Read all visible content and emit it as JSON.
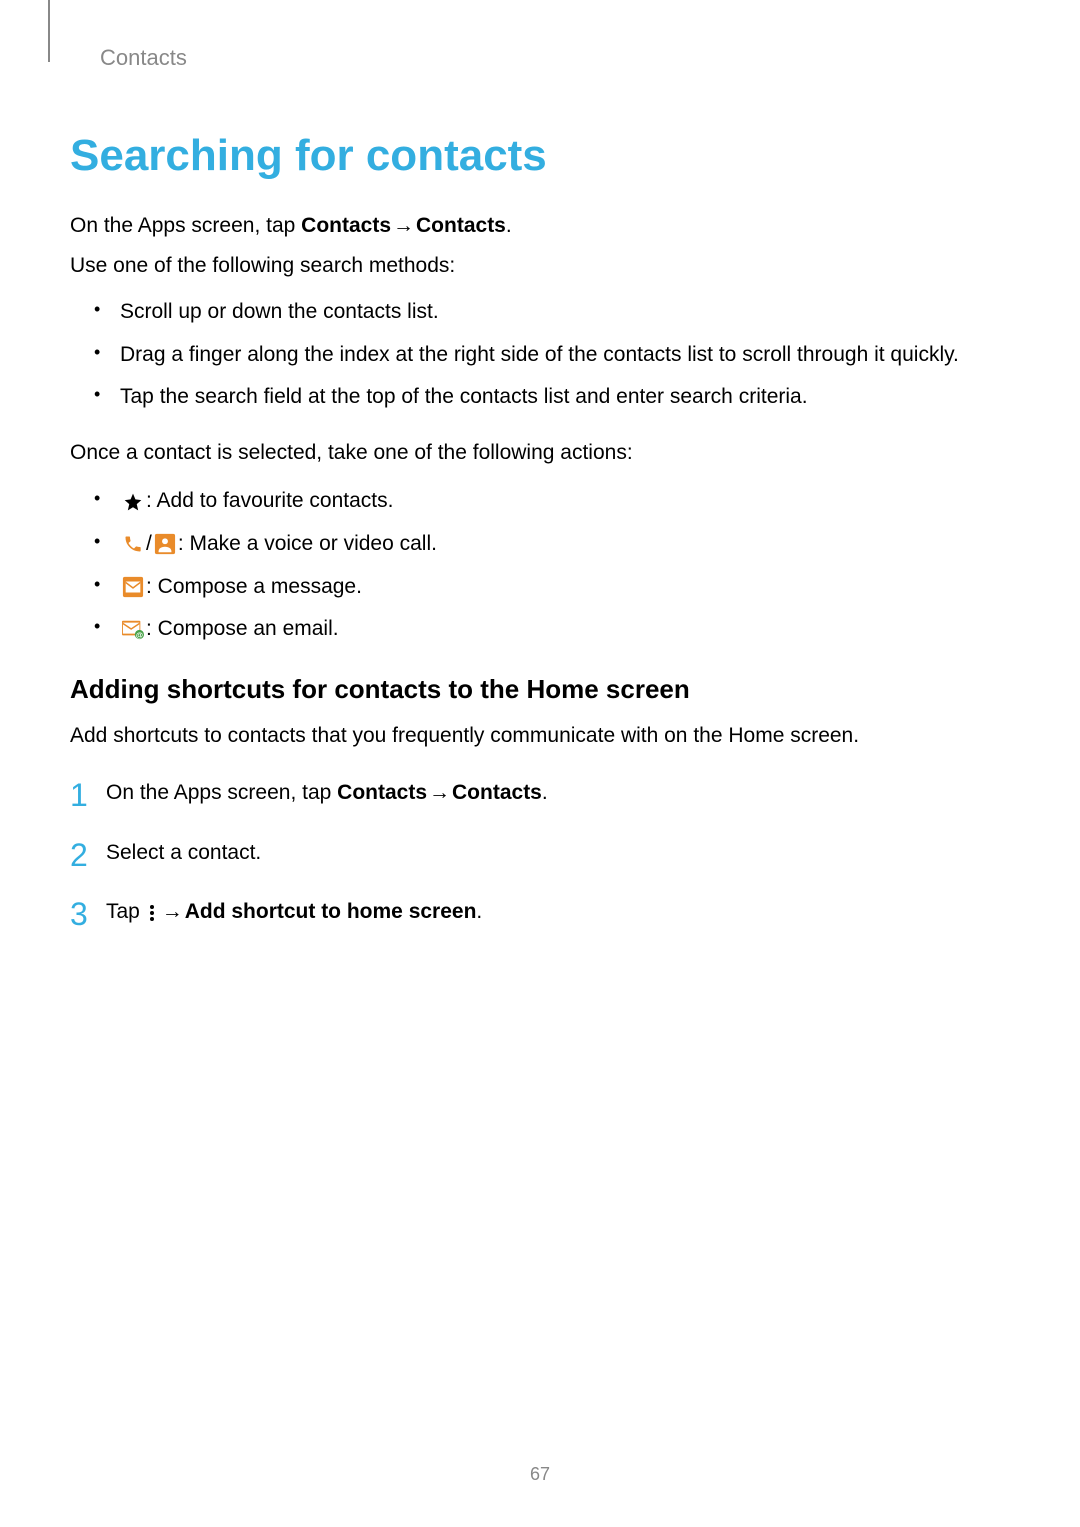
{
  "header": {
    "section": "Contacts"
  },
  "heading": "Searching for contacts",
  "intro": {
    "prefix": "On the Apps screen, tap ",
    "bold1": "Contacts",
    "arrow": " → ",
    "bold2": "Contacts",
    "suffix": "."
  },
  "intro2": "Use one of the following search methods:",
  "search_methods": [
    "Scroll up or down the contacts list.",
    "Drag a finger along the index at the right side of the contacts list to scroll through it quickly.",
    "Tap the search field at the top of the contacts list and enter search criteria."
  ],
  "after_select": "Once a contact is selected, take one of the following actions:",
  "actions": {
    "favourite": " : Add to favourite contacts.",
    "call_sep": " / ",
    "call": " : Make a voice or video call.",
    "message": " : Compose a message.",
    "email": " : Compose an email."
  },
  "subheading": "Adding shortcuts for contacts to the Home screen",
  "subintro": "Add shortcuts to contacts that you frequently communicate with on the Home screen.",
  "steps": {
    "s1": {
      "num": "1",
      "prefix": "On the Apps screen, tap ",
      "bold1": "Contacts",
      "arrow": " → ",
      "bold2": "Contacts",
      "suffix": "."
    },
    "s2": {
      "num": "2",
      "text": "Select a contact."
    },
    "s3": {
      "num": "3",
      "prefix": "Tap ",
      "arrow": " → ",
      "bold": "Add shortcut to home screen",
      "suffix": "."
    }
  },
  "page_number": "67"
}
